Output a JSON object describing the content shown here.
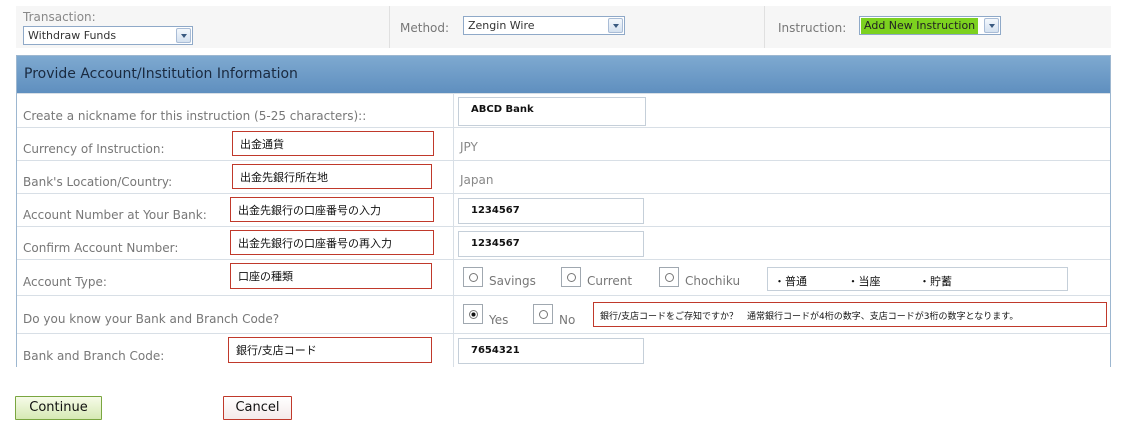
{
  "topbar": {
    "transaction_label": "Transaction:",
    "transaction_value": "Withdraw Funds",
    "method_label": "Method:",
    "method_value": "Zengin Wire",
    "instruction_label": "Instruction:",
    "instruction_value": "Add New Instruction"
  },
  "panel": {
    "title": "Provide Account/Institution Information",
    "rows": {
      "nickname": {
        "label": "Create a nickname for this instruction (5-25 characters)::",
        "value": "ABCD Bank"
      },
      "currency": {
        "label": "Currency of Instruction:",
        "annotation": "出金通貨",
        "value": "JPY"
      },
      "location": {
        "label": "Bank's Location/Country:",
        "annotation": "出金先銀行所在地",
        "value": "Japan"
      },
      "account_number": {
        "label": "Account Number at Your Bank:",
        "annotation": "出金先銀行の口座番号の入力",
        "value": "1234567"
      },
      "confirm_account": {
        "label": "Confirm Account Number:",
        "annotation": "出金先銀行の口座番号の再入力",
        "value": "1234567"
      },
      "account_type": {
        "label": "Account Type:",
        "annotation": "口座の種類",
        "options": [
          "Savings",
          "Current",
          "Chochiku"
        ],
        "note": [
          "・普通",
          "・当座",
          "・貯蓄"
        ]
      },
      "know_code": {
        "label": "Do you know your Bank and Branch Code?",
        "options": [
          "Yes",
          "No"
        ],
        "selected": "Yes",
        "note": "銀行/支店コードをご存知ですか？　通常銀行コードが4桁の数字、支店コードが3桁の数字となります。"
      },
      "branch_code": {
        "label": "Bank and Branch Code:",
        "annotation": "銀行/支店コード",
        "value": "7654321"
      }
    }
  },
  "buttons": {
    "continue_label": "Continue",
    "cancel_label": "Cancel"
  }
}
